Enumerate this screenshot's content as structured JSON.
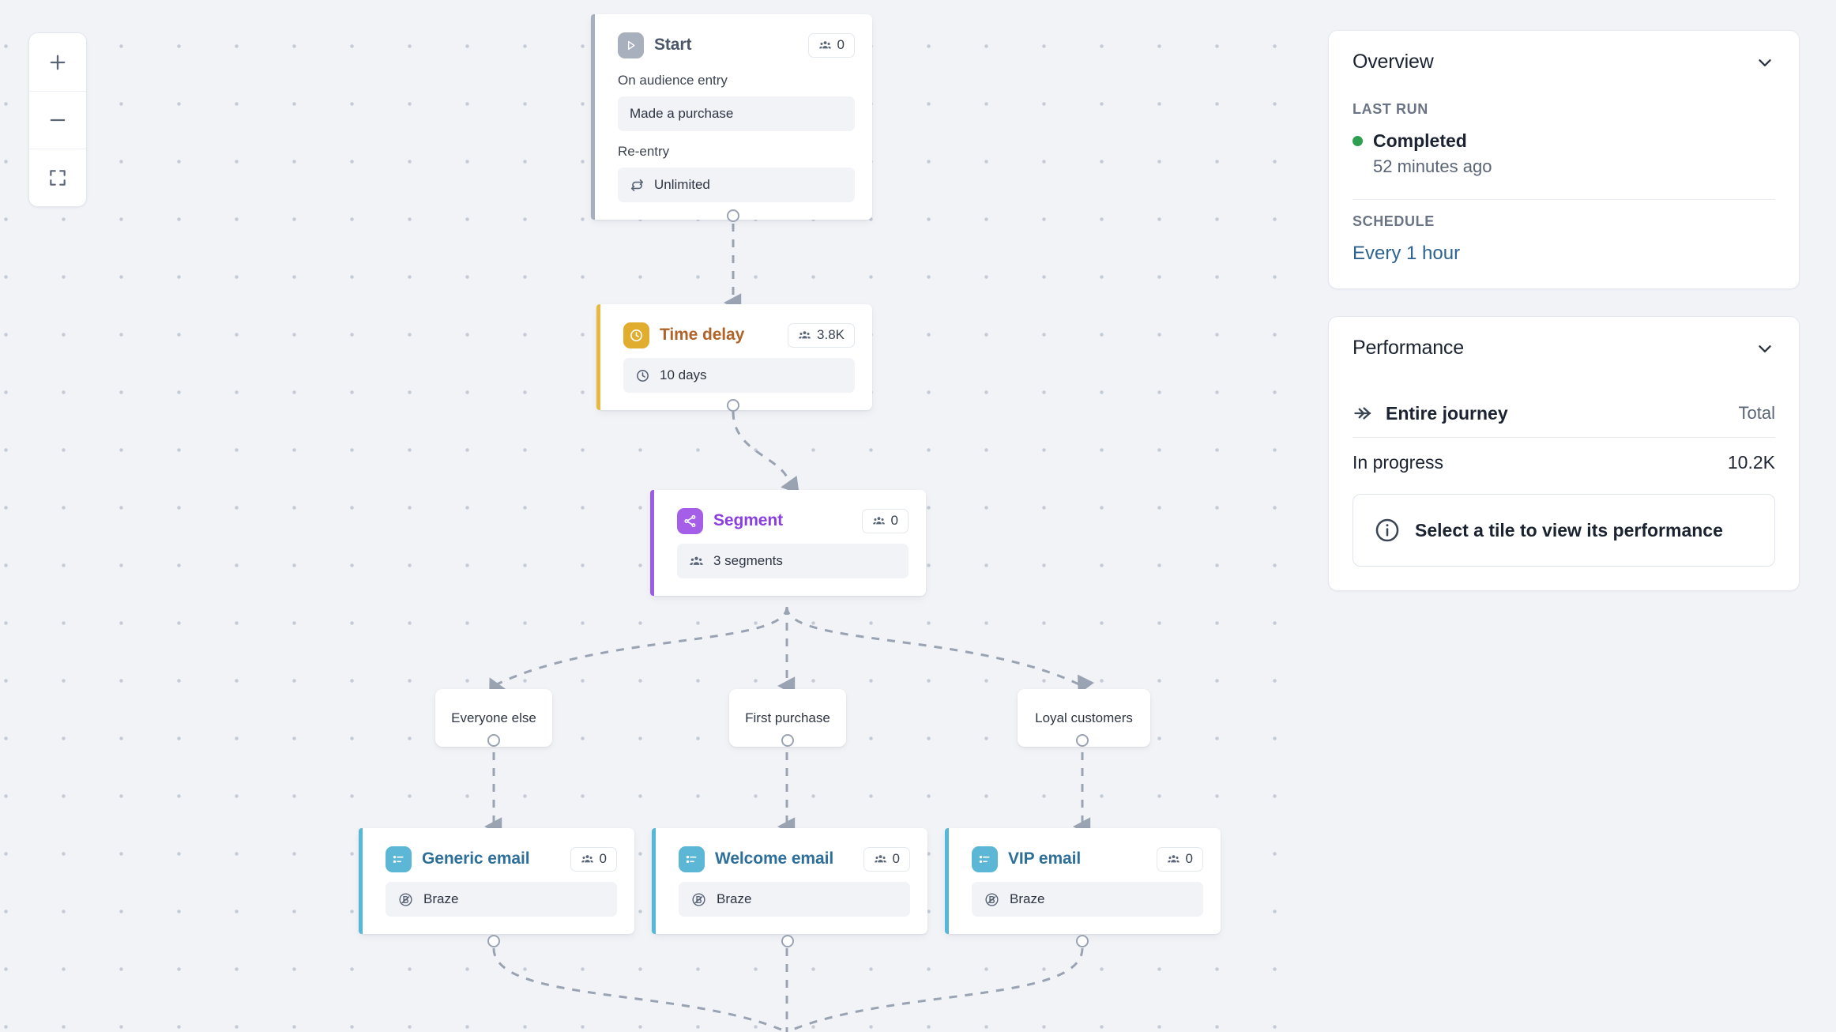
{
  "canvas": {
    "zoom_controls": [
      {
        "name": "zoom-in",
        "label": "+"
      },
      {
        "name": "zoom-out",
        "label": "−"
      },
      {
        "name": "fit-to-screen",
        "label": "Fit"
      }
    ]
  },
  "nodes": {
    "start": {
      "title": "Start",
      "icon": "play-icon",
      "accent": "#a8b0bd",
      "title_color": "#4b5768",
      "glyph_bg": "#a8b0bd",
      "badge": {
        "icon": "audience-icon",
        "count": "0"
      },
      "fields": [
        {
          "label": "On audience entry",
          "value": "Made a purchase",
          "icon": "none"
        },
        {
          "label": "Re-entry",
          "value": "Unlimited",
          "icon": "repeat-icon"
        }
      ]
    },
    "time_delay": {
      "title": "Time delay",
      "icon": "clock-icon",
      "accent": "#e8b93f",
      "title_color": "#b0642a",
      "glyph_bg": "#e0ad2f",
      "badge": {
        "icon": "audience-icon",
        "count": "3.8K"
      },
      "fields": [
        {
          "label": "",
          "value": "10 days",
          "icon": "clock-icon"
        }
      ]
    },
    "segment": {
      "title": "Segment",
      "icon": "split-icon",
      "accent": "#9b5de5",
      "title_color": "#8b3ee0",
      "glyph_bg": "#a45ee8",
      "badge": {
        "icon": "audience-icon",
        "count": "0"
      },
      "fields": [
        {
          "label": "",
          "value": "3 segments",
          "icon": "audience-icon"
        }
      ]
    },
    "generic_email": {
      "title": "Generic email",
      "icon": "email-tile-icon",
      "accent": "#57b7d9",
      "title_color": "#2e6f99",
      "glyph_bg": "#5cb6d6",
      "badge": {
        "icon": "audience-icon",
        "count": "0"
      },
      "fields": [
        {
          "label": "",
          "value": "Braze",
          "icon": "braze-icon"
        }
      ]
    },
    "welcome_email": {
      "title": "Welcome email",
      "icon": "email-tile-icon",
      "accent": "#57b7d9",
      "title_color": "#2e6f99",
      "glyph_bg": "#5cb6d6",
      "badge": {
        "icon": "audience-icon",
        "count": "0"
      },
      "fields": [
        {
          "label": "",
          "value": "Braze",
          "icon": "braze-icon"
        }
      ]
    },
    "vip_email": {
      "title": "VIP email",
      "icon": "email-tile-icon",
      "accent": "#57b7d9",
      "title_color": "#2e6f99",
      "glyph_bg": "#5cb6d6",
      "badge": {
        "icon": "audience-icon",
        "count": "0"
      },
      "fields": [
        {
          "label": "",
          "value": "Braze",
          "icon": "braze-icon"
        }
      ]
    }
  },
  "branches": [
    {
      "label": "Everyone else"
    },
    {
      "label": "First purchase"
    },
    {
      "label": "Loyal customers"
    }
  ],
  "inspector": {
    "overview": {
      "title": "Overview",
      "last_run_label": "LAST RUN",
      "status": "Completed",
      "status_color": "#2e9e4f",
      "status_time": "52 minutes ago",
      "schedule_label": "SCHEDULE",
      "schedule_value": "Every 1 hour"
    },
    "performance": {
      "title": "Performance",
      "row_title": "Entire journey",
      "row_right": "Total",
      "metric_label": "In progress",
      "metric_value": "10.2K",
      "notice": "Select a tile to view its performance"
    }
  }
}
